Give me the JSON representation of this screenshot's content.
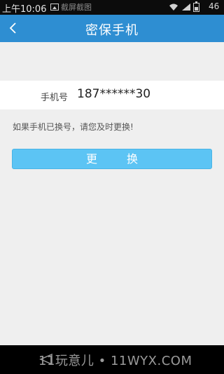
{
  "status_bar": {
    "time": "上午10:06",
    "notification": "截屏截图",
    "battery": "46"
  },
  "nav": {
    "title": "密保手机"
  },
  "phone": {
    "label": "手机号",
    "value": "187******30"
  },
  "hint": "如果手机已换号，请您及时更换!",
  "change_button": {
    "label": "更换"
  },
  "watermark": "11玩意儿 • 11WYX.COM",
  "colors": {
    "nav_background": "#2e8ed2",
    "button_background": "#5cc4f4",
    "page_background": "#efefef"
  }
}
